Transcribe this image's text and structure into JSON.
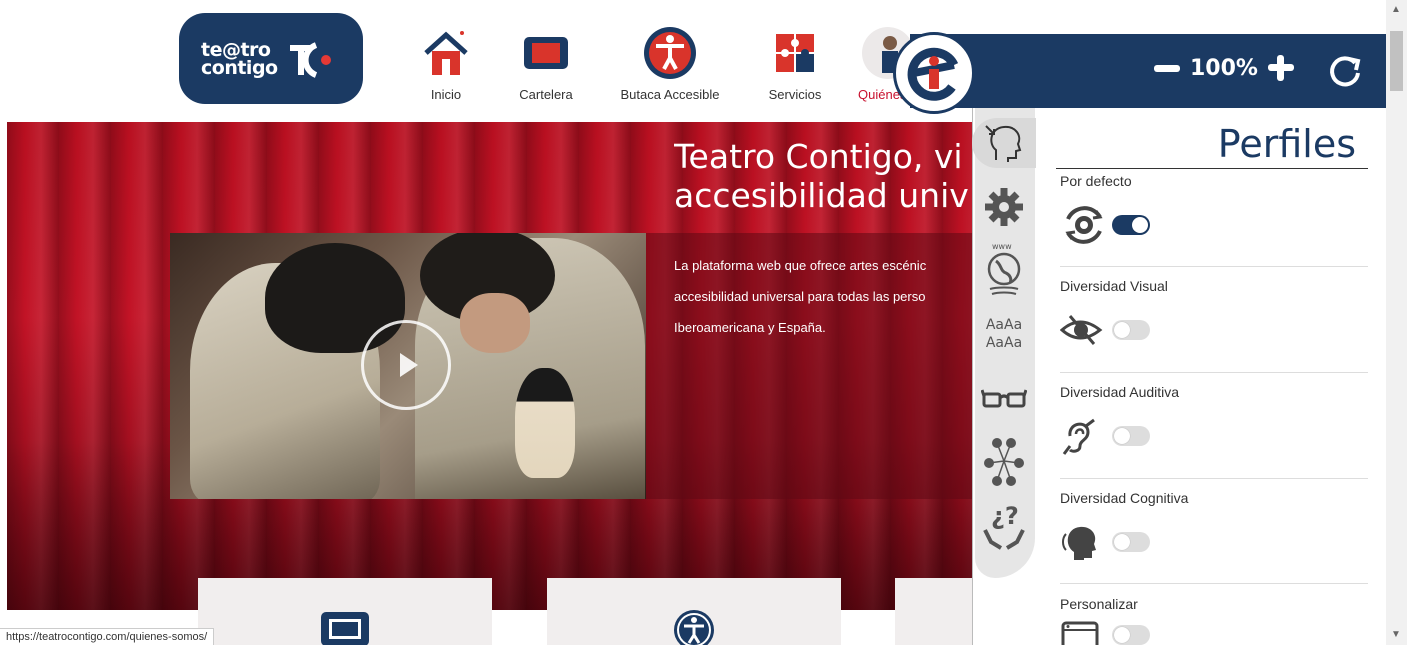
{
  "site": {
    "logo_text_line1": "te@tro",
    "logo_text_line2": "contigo",
    "brand_color": "#1b3a63",
    "accent_color": "#c8102e"
  },
  "nav": {
    "items": [
      {
        "label": "Inicio",
        "icon": "home-icon"
      },
      {
        "label": "Cartelera",
        "icon": "ticket-icon"
      },
      {
        "label": "Butaca Accesible",
        "icon": "accessibility-icon"
      },
      {
        "label": "Servicios",
        "icon": "puzzle-icon"
      },
      {
        "label": "Quiénes",
        "icon": "people-icon"
      }
    ]
  },
  "hero": {
    "title_line1": "Teatro Contigo, vi",
    "title_line2": "accesibilidad univ",
    "text_line1": "La plataforma web que ofrece artes escénic",
    "text_line2": "accesibilidad universal para todas las perso",
    "text_line3": "Iberoamericana y España."
  },
  "status_url": "https://teatrocontigo.com/quienes-somos/",
  "a11y": {
    "zoom_value": "100%",
    "panel_title": "Perfiles",
    "sidebar_aa_line1": "AaAa",
    "sidebar_aa_line2": "AaAa",
    "profiles": [
      {
        "name": "Por defecto",
        "icon": "default-profile-icon",
        "on": true
      },
      {
        "name": "Diversidad Visual",
        "icon": "eye-icon",
        "on": false
      },
      {
        "name": "Diversidad Auditiva",
        "icon": "ear-icon",
        "on": false
      },
      {
        "name": "Diversidad Cognitiva",
        "icon": "head-icon",
        "on": false
      },
      {
        "name": "Personalizar",
        "icon": "customize-icon",
        "on": false
      }
    ]
  }
}
